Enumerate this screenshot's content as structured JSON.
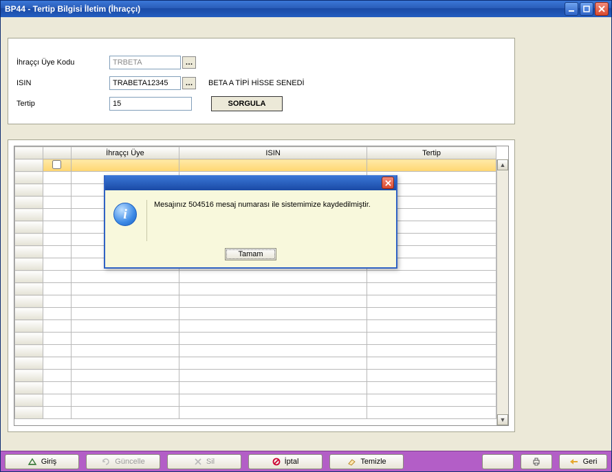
{
  "window": {
    "title": "BP44 - Tertip Bilgisi İletim (İhraççı)"
  },
  "form": {
    "issuer_code_label": "İhraççı Üye Kodu",
    "issuer_code_value": "TRBETA",
    "isin_label": "ISIN",
    "isin_value": "TRABETA12345",
    "isin_desc": "BETA A TİPİ HİSSE SENEDİ",
    "tertip_label": "Tertip",
    "tertip_value": "15",
    "query_button": "SORGULA"
  },
  "grid": {
    "columns": {
      "issuer": "İhraççı Üye",
      "isin": "ISIN",
      "tertip": "Tertip"
    }
  },
  "toolbar": {
    "enter": "Giriş",
    "update": "Güncelle",
    "delete": "Sil",
    "cancel": "İptal",
    "clear": "Temizle",
    "back": "Geri"
  },
  "dialog": {
    "message": "Mesajınız 504516 mesaj numarası ile sistemimize kaydedilmiştir.",
    "ok": "Tamam"
  }
}
